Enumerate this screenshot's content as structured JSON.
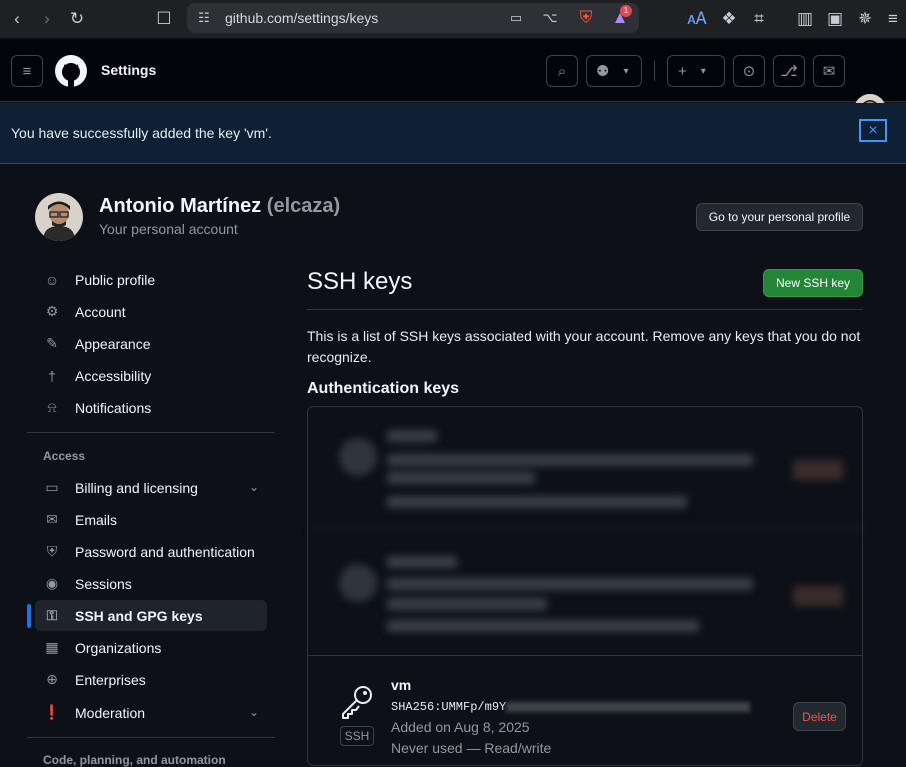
{
  "browser": {
    "url": "github.com/settings/keys",
    "notification_count": "1"
  },
  "header": {
    "title": "Settings"
  },
  "flash": {
    "message": "You have successfully added the key 'vm'.",
    "close_icon": "×"
  },
  "profile": {
    "name": "Antonio Martínez",
    "handle": "(elcaza)",
    "subtitle": "Your personal account",
    "profile_button": "Go to your personal profile"
  },
  "sidebar": {
    "items": [
      {
        "label": "Public profile",
        "icon": "person-icon"
      },
      {
        "label": "Account",
        "icon": "gear-icon"
      },
      {
        "label": "Appearance",
        "icon": "paintbrush-icon"
      },
      {
        "label": "Accessibility",
        "icon": "accessibility-icon"
      },
      {
        "label": "Notifications",
        "icon": "bell-icon"
      }
    ],
    "access_heading": "Access",
    "access_items": [
      {
        "label": "Billing and licensing",
        "icon": "credit-card-icon"
      },
      {
        "label": "Emails",
        "icon": "mail-icon"
      },
      {
        "label": "Password and authentication",
        "icon": "shield-lock-icon"
      },
      {
        "label": "Sessions",
        "icon": "broadcast-icon"
      },
      {
        "label": "SSH and GPG keys",
        "icon": "key-icon"
      },
      {
        "label": "Organizations",
        "icon": "organization-icon"
      },
      {
        "label": "Enterprises",
        "icon": "globe-icon"
      },
      {
        "label": "Moderation",
        "icon": "report-icon"
      }
    ],
    "code_heading": "Code, planning, and automation"
  },
  "main": {
    "title": "SSH keys",
    "new_key_button": "New SSH key",
    "description": "This is a list of SSH keys associated with your account. Remove any keys that you do not recognize.",
    "auth_heading": "Authentication keys",
    "key": {
      "title": "vm",
      "fingerprint": "SHA256:UMMFp/m9Y",
      "added": "Added on Aug 8, 2025",
      "usage": "Never used — Read/write",
      "badge": "SSH",
      "delete_button": "Delete"
    }
  }
}
